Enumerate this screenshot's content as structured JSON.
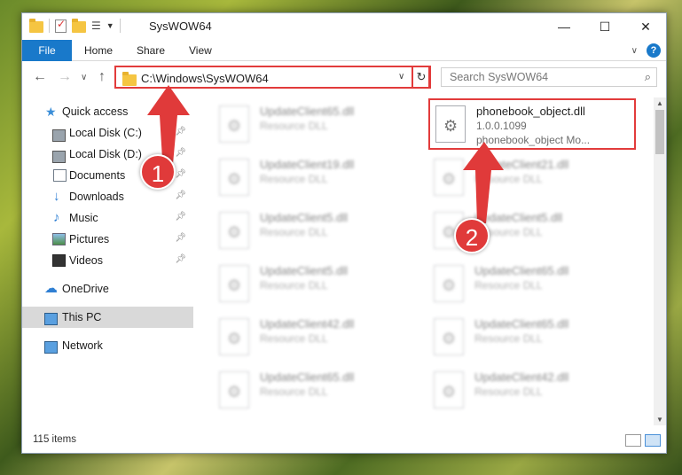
{
  "window": {
    "title": "SysWOW64",
    "controls": [
      "—",
      "☐",
      "✕"
    ]
  },
  "ribbon": {
    "tabs": [
      "File",
      "Home",
      "Share",
      "View"
    ]
  },
  "nav": {
    "address": "C:\\Windows\\SysWOW64",
    "search_placeholder": "Search SysWOW64"
  },
  "sidebar": {
    "items": [
      {
        "label": "Quick access",
        "icon": "star-icon"
      },
      {
        "label": "Local Disk (C:)",
        "icon": "disk-icon",
        "pinned": true
      },
      {
        "label": "Local Disk (D:)",
        "icon": "disk-icon",
        "pinned": true
      },
      {
        "label": "Documents",
        "icon": "documents-icon",
        "pinned": true
      },
      {
        "label": "Downloads",
        "icon": "downloads-icon",
        "pinned": true
      },
      {
        "label": "Music",
        "icon": "music-icon",
        "pinned": true
      },
      {
        "label": "Pictures",
        "icon": "pictures-icon",
        "pinned": true
      },
      {
        "label": "Videos",
        "icon": "videos-icon",
        "pinned": true
      },
      {
        "label": "OneDrive",
        "icon": "onedrive-icon"
      },
      {
        "label": "This PC",
        "icon": "this-pc-icon",
        "selected": true
      },
      {
        "label": "Network",
        "icon": "network-icon"
      }
    ]
  },
  "files": [
    {
      "name": "UpdateClient65.dll",
      "type": "Resource DLL"
    },
    {
      "name": "phonebook_object.dll",
      "version": "1.0.0.1099",
      "desc": "phonebook_object Mo...",
      "highlighted": true
    },
    {
      "name": "UpdateClient19.dll",
      "type": "Resource DLL"
    },
    {
      "name": "UpdateClient21.dll",
      "type": "Resource DLL"
    },
    {
      "name": "UpdateClient5.dll",
      "type": "Resource DLL"
    },
    {
      "name": "UpdateClient5.dll",
      "type": "Resource DLL"
    },
    {
      "name": "UpdateClient5.dll",
      "type": "Resource DLL"
    },
    {
      "name": "UpdateClient65.dll",
      "type": "Resource DLL"
    },
    {
      "name": "UpdateClient42.dll",
      "type": "Resource DLL"
    },
    {
      "name": "UpdateClient65.dll",
      "type": "Resource DLL"
    },
    {
      "name": "UpdateClient65.dll",
      "type": "Resource DLL"
    },
    {
      "name": "UpdateClient42.dll",
      "type": "Resource DLL"
    }
  ],
  "status": {
    "count": "115 items"
  },
  "annotations": {
    "step1": "1",
    "step2": "2",
    "color": "#e03a3a"
  }
}
